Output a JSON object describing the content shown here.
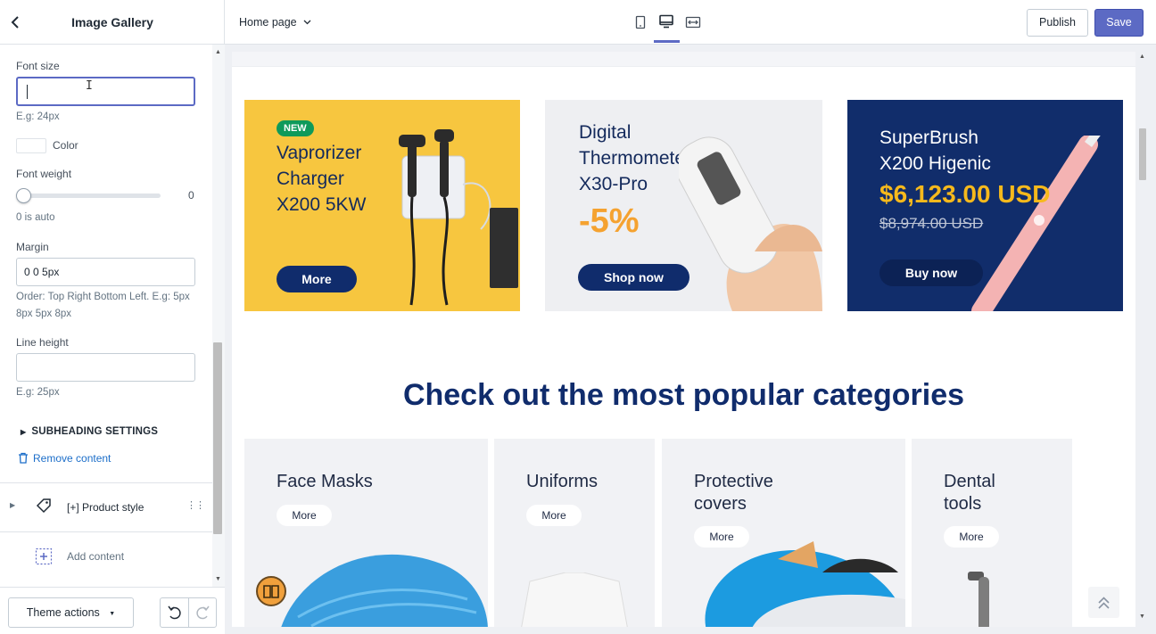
{
  "sidebar": {
    "title": "Image Gallery",
    "fields": {
      "font_size_label": "Font size",
      "font_size_hint": "E.g: 24px",
      "color_label": "Color",
      "font_weight_label": "Font weight",
      "font_weight_value": "0",
      "font_weight_hint": "0 is auto",
      "margin_label": "Margin",
      "margin_value": "0 0 5px",
      "margin_hint": "Order: Top Right Bottom Left. E.g: 5px 8px 5px 8px",
      "line_height_label": "Line height",
      "line_height_hint": "E.g: 25px"
    },
    "subheading_settings": "SUBHEADING SETTINGS",
    "remove_content": "Remove content",
    "product_style": "[+] Product style",
    "add_content": "Add content",
    "theme_actions": "Theme actions"
  },
  "topbar": {
    "page": "Home page",
    "publish": "Publish",
    "save": "Save",
    "accent": "#5c6ac4"
  },
  "preview": {
    "banners": [
      {
        "badge": "NEW",
        "title_lines": [
          "Vaprorizer",
          "Charger",
          "X200 5KW"
        ],
        "button": "More"
      },
      {
        "title_lines": [
          "Digital",
          "Thermometer",
          "X30-Pro"
        ],
        "discount": "-5%",
        "button": "Shop now"
      },
      {
        "title_lines": [
          "SuperBrush",
          "X200 Higenic"
        ],
        "price": "$6,123.00 USD",
        "old_price": "$8,974.00 USD",
        "button": "Buy now"
      }
    ],
    "section_title": "Check out the most popular categories",
    "categories": [
      {
        "title_lines": [
          "Face Masks"
        ],
        "button": "More"
      },
      {
        "title_lines": [
          "Uniforms"
        ],
        "button": "More"
      },
      {
        "title_lines": [
          "Protective",
          "covers"
        ],
        "button": "More"
      },
      {
        "title_lines": [
          "Dental",
          "tools"
        ],
        "button": "More"
      }
    ]
  }
}
